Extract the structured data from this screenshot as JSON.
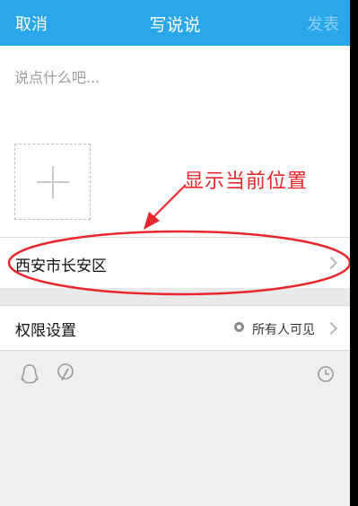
{
  "header": {
    "cancel_label": "取消",
    "title": "写说说",
    "publish_label": "发表"
  },
  "compose": {
    "placeholder": "说点什么吧..."
  },
  "annotation": {
    "text": "显示当前位置",
    "color": "#e8262b"
  },
  "location": {
    "label": "西安市长安区"
  },
  "permissions": {
    "label": "权限设置",
    "value": "所有人可见"
  },
  "toolbar": {
    "icons": [
      "qq-penguin-icon",
      "mention-icon",
      "clock-icon"
    ]
  },
  "colors": {
    "header_bg": "#2aa6ea",
    "publish_disabled": "#8fd0f4"
  }
}
